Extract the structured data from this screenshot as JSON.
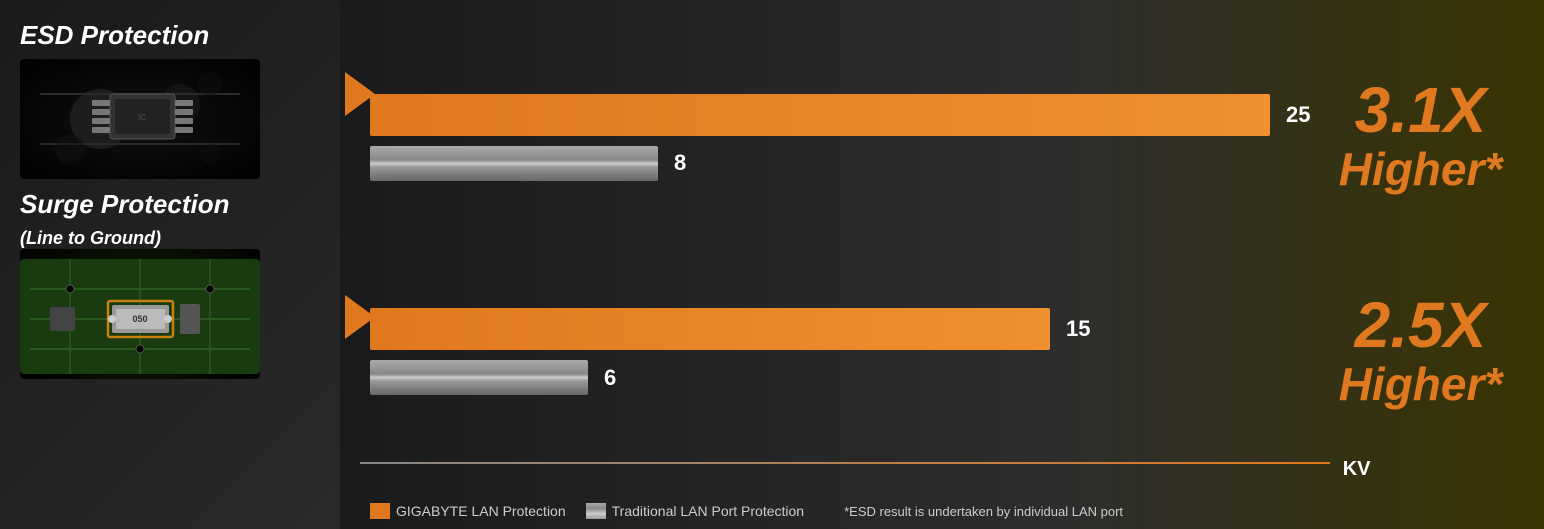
{
  "left": {
    "esd_title": "ESD Protection",
    "surge_title": "Surge Protection",
    "surge_subtitle": "(Line to Ground)"
  },
  "chart": {
    "bar1_value": 25,
    "bar2_value": 8,
    "bar3_value": 15,
    "bar4_value": 6,
    "multiplier1": "3.1X",
    "higher1": "Higher*",
    "multiplier2": "2.5X",
    "higher2": "Higher*",
    "axis_label": "KV"
  },
  "legend": {
    "item1_label": "GIGABYTE LAN Protection",
    "item2_label": "Traditional LAN Port Protection",
    "note": "*ESD result is undertaken by individual LAN port"
  }
}
